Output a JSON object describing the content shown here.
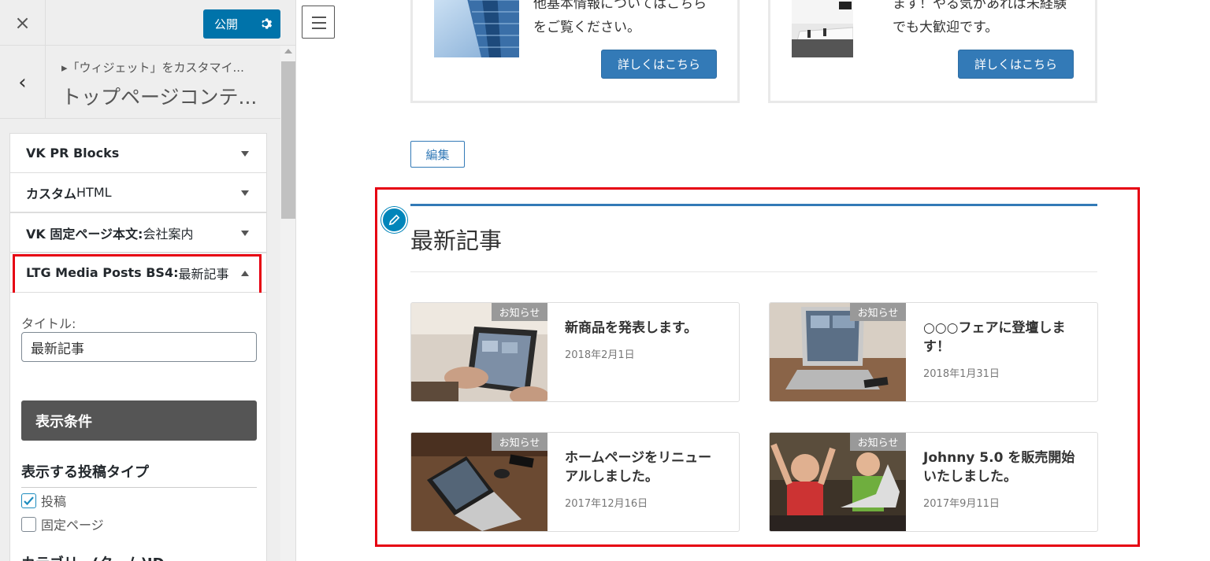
{
  "sidebar": {
    "close_icon": "×",
    "publish_label": "公開",
    "back_icon": "‹",
    "breadcrumb": "▸「ウィジェット」をカスタマイ...",
    "section_title": "トップページコンテ...",
    "widgets": [
      {
        "label": "VK PR Blocks",
        "extra": ""
      },
      {
        "label": "カスタム",
        "extra": " HTML"
      },
      {
        "label": "VK 固定ページ本文:",
        "extra": " 会社案内"
      },
      {
        "label": "LTG Media Posts BS4:",
        "extra": " 最新記事"
      }
    ],
    "form": {
      "title_label": "タイトル:",
      "title_value": "最新記事",
      "display_conditions_label": "表示条件",
      "post_type_heading": "表示する投稿タイプ",
      "checkboxes": [
        {
          "label": "投稿",
          "checked": true
        },
        {
          "label": "固定ページ",
          "checked": false
        }
      ],
      "category_heading": "カテゴリー(ターム)ID"
    }
  },
  "preview": {
    "pr_cards": [
      {
        "line1": "他基本情報についてはこちら",
        "line2": "をご覧ください。",
        "button": "詳しくはこちら"
      },
      {
        "line1": "ます！やる気があれば未経験",
        "line2": "でも大歓迎です。",
        "button": "詳しくはこちら"
      }
    ],
    "edit_label": "編集",
    "section_title": "最新記事",
    "posts": [
      {
        "badge": "お知らせ",
        "title_lines": [
          "新商品を発表します。"
        ],
        "date": "2018年2月1日"
      },
      {
        "badge": "お知らせ",
        "title_lines": [
          "○○○フェアに登壇しま",
          "す！"
        ],
        "date": "2018年1月31日"
      },
      {
        "badge": "お知らせ",
        "title_lines": [
          "ホームページをリニュー",
          "アルしました。"
        ],
        "date": "2017年12月16日"
      },
      {
        "badge": "お知らせ",
        "title_lines": [
          "Johnny 5.0 を販売開始",
          "いたしました。"
        ],
        "date": "2017年9月11日"
      }
    ]
  },
  "colors": {
    "accent_blue": "#0073aa",
    "button_blue": "#337ab7",
    "highlight_red": "#e60012"
  }
}
